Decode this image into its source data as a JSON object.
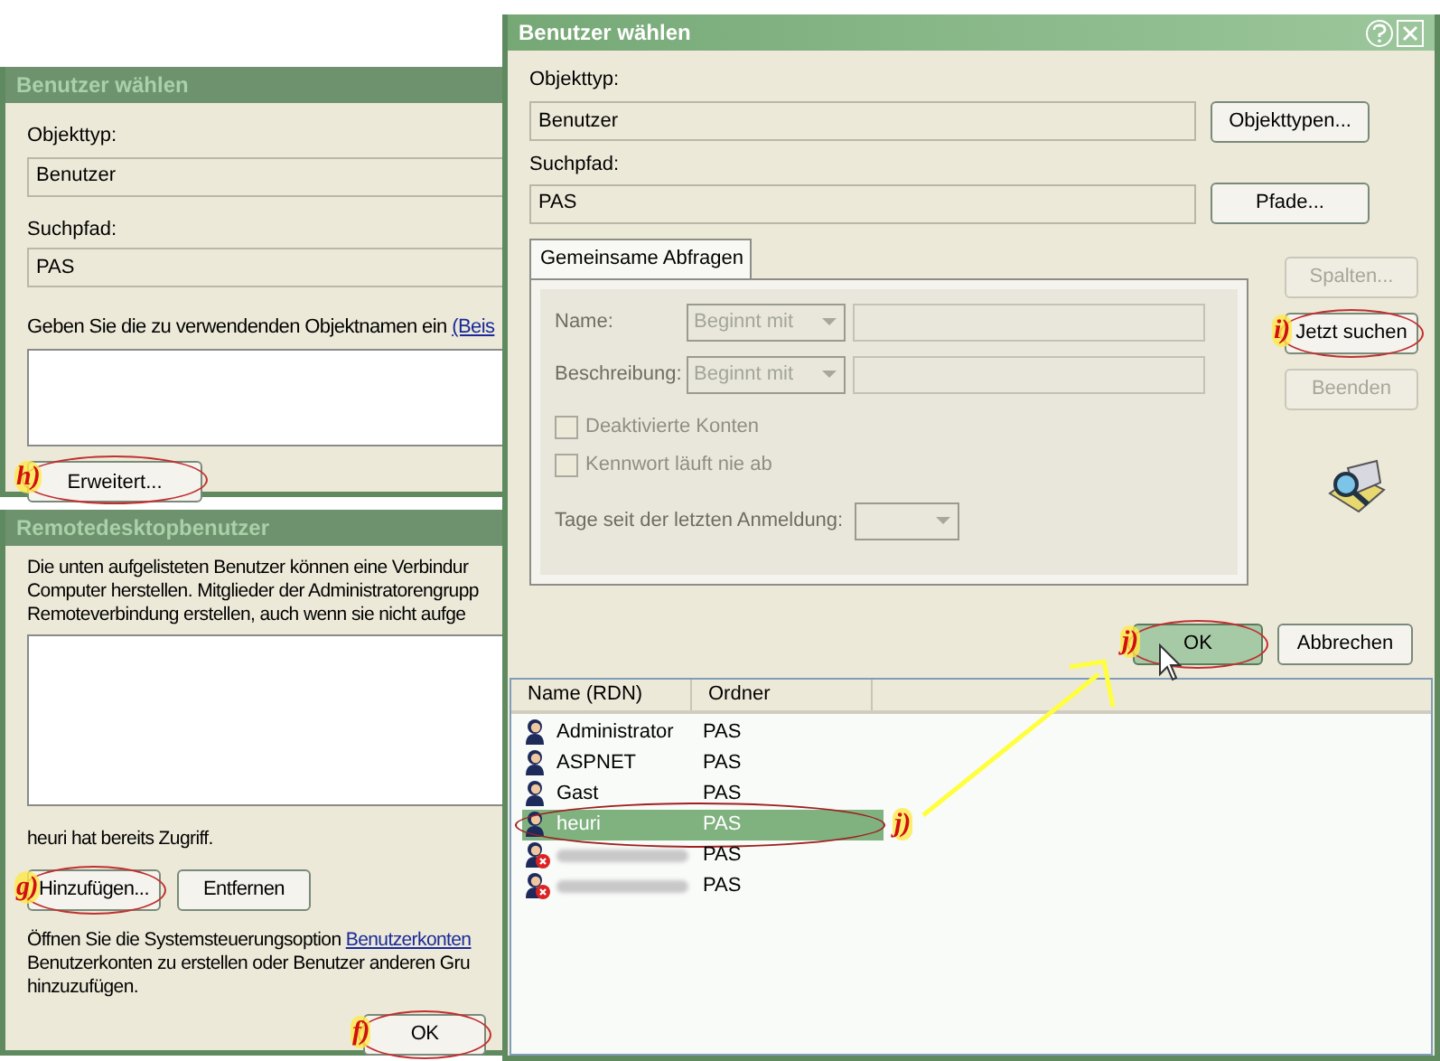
{
  "back_dialog": {
    "title": "Benutzer wählen",
    "object_type_label": "Objekttyp:",
    "object_type": "Benutzer",
    "path_label": "Suchpfad:",
    "path": "PAS",
    "names_label": "Geben Sie die zu verwendenden Objektnamen ein",
    "names_link": "(Beis",
    "buttons": [
      {
        "label": "Erweitert...",
        "callout": "h)"
      }
    ]
  },
  "remote_dialog": {
    "title": "Remotedesktopbenutzer",
    "intro_lines": [
      "Die unten aufgelisteten Benutzer können eine Verbindur",
      "Computer herstellen. Mitglieder der Administratorengrupp",
      "Remoteverbindung erstellen, auch wenn sie nicht aufge"
    ],
    "access_note": "heuri hat bereits Zugriff.",
    "buttons": [
      {
        "label": "Hinzufügen...",
        "callout": "g)"
      },
      {
        "label": "Entfernen"
      }
    ],
    "footer_line1": "Öffnen Sie die Systemsteuerungsoption",
    "footer_link": "Benutzerkonten",
    "footer_lines": [
      "Benutzerkonten zu erstellen oder Benutzer anderen Gru",
      "hinzuzufügen."
    ],
    "ok_button": {
      "label": "OK",
      "callout": "f)"
    }
  },
  "select_dialog": {
    "title": "Benutzer wählen",
    "object_type_label": "Objekttyp:",
    "object_type": "Benutzer",
    "object_type_button": "Objekttypen...",
    "path_label": "Suchpfad:",
    "path": "PAS",
    "path_button": "Pfade...",
    "tab": {
      "label": "Gemeinsame Abfragen",
      "selected": true
    },
    "query_rows": [
      {
        "label": "Name:",
        "mode": "Beginnt mit",
        "disabled": true
      },
      {
        "label": "Beschreibung:",
        "mode": "Beginnt mit",
        "disabled": true
      }
    ],
    "checkboxes": [
      {
        "label": "Deaktivierte Konten",
        "checked": false,
        "disabled": true
      },
      {
        "label": "Kennwort läuft nie ab",
        "checked": false,
        "disabled": true
      }
    ],
    "days_label": "Tage seit der letzten Anmeldung:",
    "side_buttons": [
      {
        "label": "Spalten...",
        "disabled": true
      },
      {
        "label": "Jetzt suchen",
        "disabled": false,
        "callout": "i)"
      },
      {
        "label": "Beenden",
        "disabled": true
      }
    ],
    "ok_button": {
      "label": "OK",
      "callout": "j)"
    },
    "cancel_button": {
      "label": "Abbrechen"
    },
    "results": {
      "columns": [
        "Name (RDN)",
        "Ordner"
      ],
      "rows": [
        {
          "kind": "user",
          "name": "Administrator",
          "folder": "PAS",
          "selected": false
        },
        {
          "kind": "user",
          "name": "ASPNET",
          "folder": "PAS",
          "selected": false
        },
        {
          "kind": "user",
          "name": "Gast",
          "folder": "PAS",
          "selected": false
        },
        {
          "kind": "user",
          "name": "heuri",
          "folder": "PAS",
          "selected": true,
          "callout": "j)"
        },
        {
          "kind": "disabled",
          "folder": "PAS",
          "selected": false
        },
        {
          "kind": "disabled",
          "folder": "PAS",
          "selected": false
        }
      ]
    }
  }
}
